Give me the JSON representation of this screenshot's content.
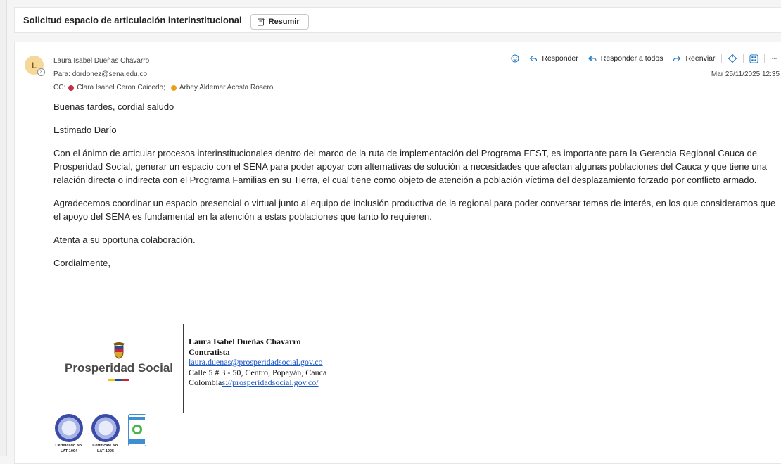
{
  "subject": {
    "title": "Solicitud espacio de articulación interinstitucional",
    "summarize_label": "Resumir"
  },
  "message": {
    "avatar_initial": "L",
    "sender": "Laura Isabel Dueñas Chavarro",
    "to_label": "Para:",
    "to": "dordonez@sena.edu.co",
    "cc_label": "CC:",
    "cc": [
      "Clara Isabel Ceron Caicedo;",
      "Arbey Aldemar Acosta Rosero"
    ],
    "date": "Mar 25/11/2025 12:35",
    "actions": {
      "reply": "Responder",
      "reply_all": "Responder a todos",
      "forward": "Reenviar",
      "more": "···"
    },
    "body": [
      "Buenas tardes, cordial saludo",
      "Estimado Darío",
      "Con el ánimo de articular procesos interinstitucionales dentro del marco de la ruta de implementación del Programa FEST, es importante para la Gerencia Regional Cauca de Prosperidad Social, generar un espacio con el SENA para poder apoyar con alternativas de solución a necesidades que afectan algunas poblaciones del Cauca y que tiene una relación directa o indirecta con el Programa Familias en su Tierra, el cual tiene como objeto de atención a población víctima del desplazamiento forzado por conflicto armado.",
      "Agradecemos coordinar un espacio presencial o virtual junto al equipo de inclusión productiva de la regional para poder conversar temas de interés, en los que consideramos que el apoyo del SENA es fundamental en la atención a estas poblaciones que tanto lo requieren.",
      "Atenta a su oportuna colaboración.",
      "Cordialmente,"
    ]
  },
  "signature": {
    "brand": "Prosperidad Social",
    "name": "Laura Isabel Dueñas Chavarro",
    "role": "Contratista",
    "email": "laura.duenas@prosperidadsocial.gov.co",
    "address": "Calle 5 # 3 - 50, Centro, Popayán, Cauca",
    "country_prefix": "Colombia",
    "site_link": "s://prosperidadsocial.gov.co/",
    "certs": [
      {
        "label1": "Certificado No.",
        "label2": "LAT-1004"
      },
      {
        "label1": "Certificate No.",
        "label2": "LAT-1005"
      }
    ],
    "flag_colors": [
      "#f3c300",
      "#1f4ea1",
      "#d1202f"
    ]
  },
  "colors": {
    "accent": "#0f6cbd",
    "avatar_bg": "#f6d99a"
  }
}
